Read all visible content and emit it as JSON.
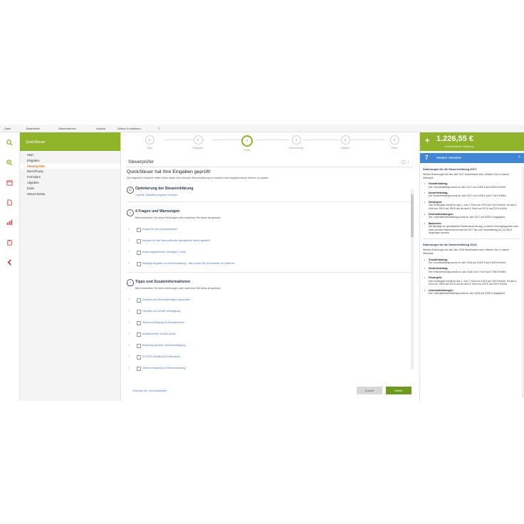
{
  "menu": [
    "Datei",
    "Bearbeiten",
    "Steuerthemen",
    "Ansicht",
    "Online-Funktionen",
    "?"
  ],
  "sidebar_icons": [
    "search-icon",
    "audit-icon",
    "calendar-icon",
    "document-icon",
    "chart-icon",
    "clipboard-icon",
    "chevron-left-icon"
  ],
  "nav": {
    "header": "QuickSteuer",
    "items": [
      "Start",
      "Eingaben",
      "Steuerprüfer",
      "Berechnung",
      "Formulare",
      "Abgeben",
      "Ende",
      "Steuer Extras"
    ],
    "active_index": 2
  },
  "stepper": {
    "steps": [
      {
        "num": "1",
        "label": "Start"
      },
      {
        "num": "2",
        "label": "Eingaben"
      },
      {
        "num": "3",
        "label": "Prüfer"
      },
      {
        "num": "4",
        "label": "Berechnung"
      },
      {
        "num": "5",
        "label": "Abgabe"
      },
      {
        "num": "6",
        "label": "Ende"
      }
    ],
    "current_index": 2
  },
  "main": {
    "subheader": "Steuerprüfer",
    "title": "QuickSteuer hat Ihre Eingaben geprüft!",
    "intro": "Die folgenden Hinweise helfen Ihnen dabei eine korrekte Steuererklärung zu erstellen und möglicherweise Steuern zu sparen.",
    "sections": {
      "optimize": {
        "title": "Optimierung der Steuererklärung",
        "link": "Optimal: Sämtliche Angaben erhoben"
      },
      "warnings": {
        "title": "4 Fragen und Warnungen",
        "subtitle": "Bitte bearbeiten Sie diese Meldungen oder markieren Sie diese als gelesen",
        "items": [
          "Kosten für den Hauptwohnsitz?",
          "Wurden für Ihre Steuerpflichten aktualisierte Werte gewählt?",
          "Änderungsbescheid: benötigen? (Mai)",
          "Wichtige Angaben zur Steuererklärung - bitte prüfen Sie die Auswahl für Weiteres"
        ]
      },
      "tips": {
        "title": "Tipps und Zusatzinformationen",
        "subtitle": "Bitte bearbeiten Sie diese Meldungen oder markieren Sie diese als gelesen",
        "items": [
          "Zeitraum des Steuerpflichtigen überprüfen",
          "Hinweise zur Art der Veranlagung",
          "Steuerermäßigung für Energiekosten",
          "Arbeitszimmer: Kosten prüfen",
          "Beantragung einer Steuerermäßigung",
          "ELSTER-Zertifikat für Datenabruf",
          "Weitere Hinweise zur Steuererklärung"
        ]
      }
    },
    "footer": {
      "link": "Vorschau ein- und ausblenden",
      "back": "Zurück",
      "next": "Weiter"
    }
  },
  "right": {
    "refund_amount": "1.226,55 €",
    "refund_label": "Voraussichtliche Erstattung",
    "hints_count": "7",
    "hints_title": "Weitere Hinweise",
    "blocks": [
      {
        "heading": "Änderungen für die Steuererklärung 2017:",
        "intro": "Welche Änderungen für das Jahr 2017 beschlossen wird, erfahren Sie in unserer Übersicht:",
        "items": [
          {
            "title": "Grundfreibetrag:",
            "text": "Der Grundfreibetrag wurde im Jahr 2017 von 8.652 € auf 8.820 € erhöht."
          },
          {
            "title": "Kinderfreibetrag:",
            "text": "Der Kinderfreibetrag wurde im Jahr 2017 von 4.608 € auf 4.716 € erhöht."
          },
          {
            "title": "Kindergeld:",
            "text": "Das Kindergeld wurde für das 1. und 2. Kind von 190 € auf 192 € erhöht, für das 3. Kind von 196 € auf 198 € und ab dem 4. Kind von 221 € auf 223 € erhöht."
          },
          {
            "title": "Unterhaltsleistungen:",
            "text": "Der Unterhaltshöchstbetrag wurde im Jahr 2017 auf 8.820 € angepasst."
          },
          {
            "title": "Basisrente:",
            "text": "Die Beiträge zur gesetzlichen Rentenversicherung, zu einem Versorgungswerk oder einer privaten Basisrente können ab 2017 bis zum Höchstbetrag von 23.362 € abgezogen werden."
          }
        ]
      },
      {
        "heading": "Änderungen für die Steuererklärung 2018:",
        "intro": "Welche Änderungen für das Jahr 2018 beschlossen wird, erfahren Sie in unserer Übersicht:",
        "items": [
          {
            "title": "Grundfreibetrag:",
            "text": "Der Grundfreibetrag wurde im Jahr 2018 von 8.820 € auf 9.000 € erhöht."
          },
          {
            "title": "Kinderfreibetrag:",
            "text": "Der Kinderfreibetrag wurde im Jahr 2018 von 4.716 € auf 4.788 € erhöht."
          },
          {
            "title": "Kindergeld:",
            "text": "Das Kindergeld wurde für das 1. und 2. Kind von 192 € auf 194 € erhöht, für das 3. Kind von 198 € auf 200 € und ab dem 4. Kind von 223 € auf 225 € erhöht."
          },
          {
            "title": "Unterhaltsleistungen:",
            "text": "Der Unterhaltshöchstbetrag wurde im Jahr 2018 auf 9.000 € angepasst."
          }
        ]
      }
    ]
  },
  "colors": {
    "brand_green": "#8fb42a",
    "button_green": "#6e9a1e",
    "hint_blue": "#3f87d6",
    "active_orange": "#e07020",
    "link_blue": "#4a7bc4"
  }
}
